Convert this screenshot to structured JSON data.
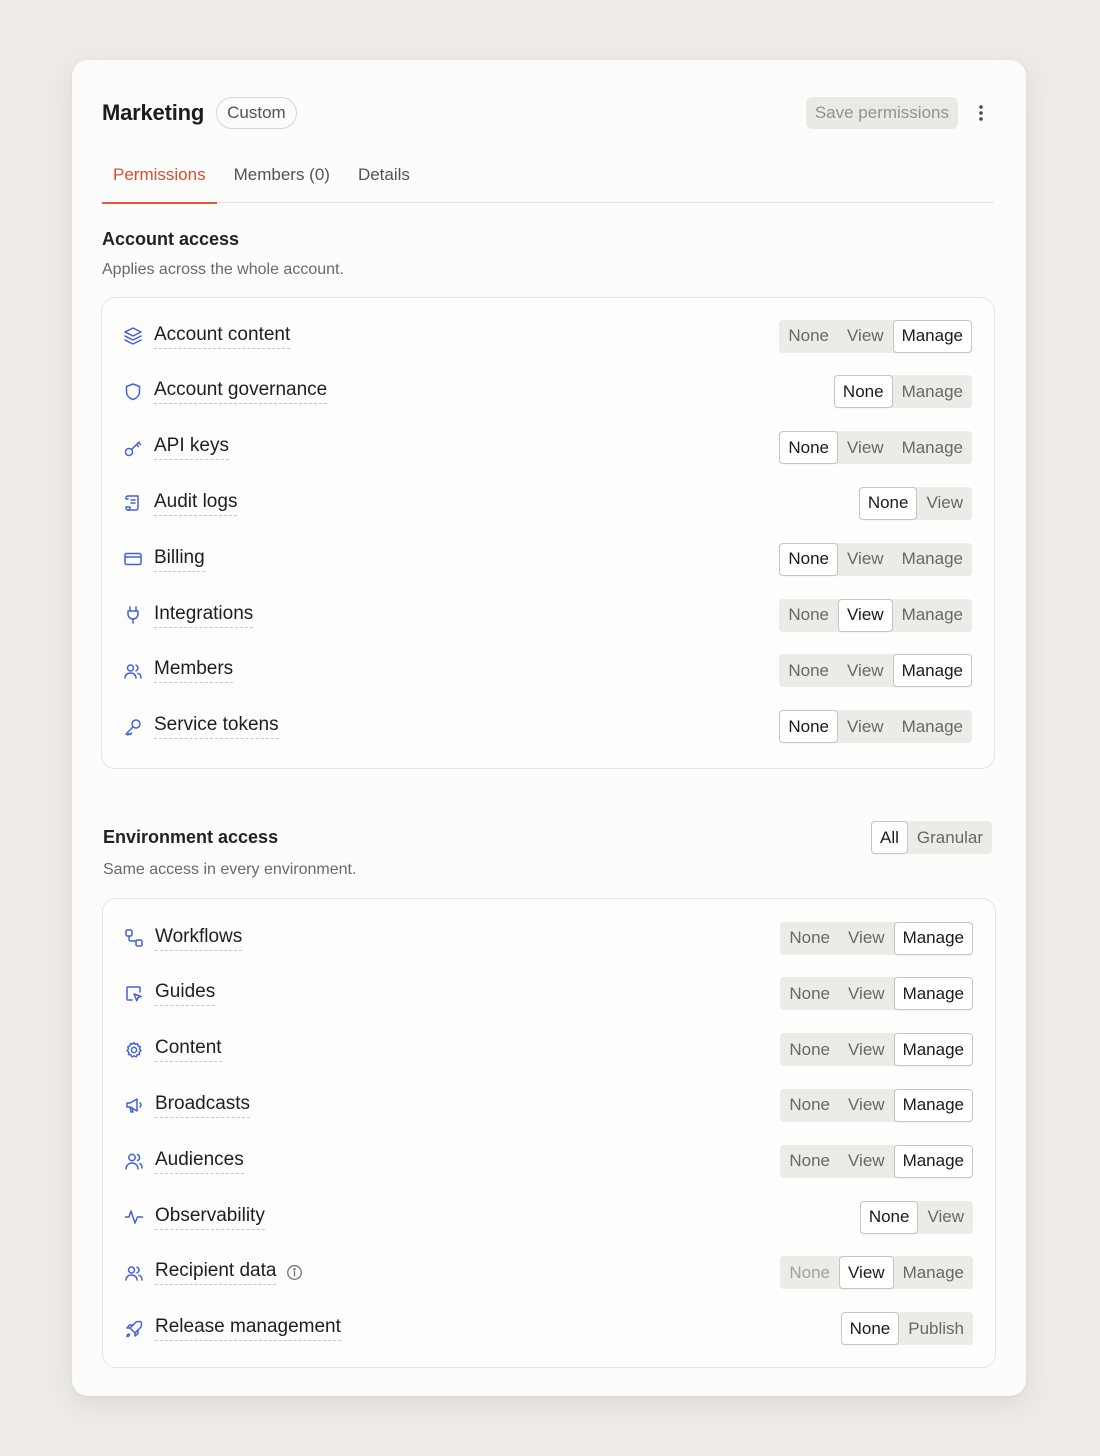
{
  "header": {
    "title": "Marketing",
    "badge": "Custom",
    "save_label": "Save permissions",
    "more_icon": "more-vertical-icon"
  },
  "tabs": [
    {
      "label": "Permissions",
      "active": true
    },
    {
      "label": "Members (0)",
      "active": false
    },
    {
      "label": "Details",
      "active": false
    }
  ],
  "account_access": {
    "title": "Account access",
    "subtitle": "Applies across the whole account.",
    "rows": [
      {
        "label": "Account content",
        "icon": "layers-icon",
        "options": [
          "None",
          "View",
          "Manage"
        ],
        "selected": "Manage"
      },
      {
        "label": "Account governance",
        "icon": "shield-icon",
        "options": [
          "None",
          "Manage"
        ],
        "selected": "None"
      },
      {
        "label": "API keys",
        "icon": "key-icon",
        "options": [
          "None",
          "View",
          "Manage"
        ],
        "selected": "None"
      },
      {
        "label": "Audit logs",
        "icon": "scroll-icon",
        "options": [
          "None",
          "View"
        ],
        "selected": "None"
      },
      {
        "label": "Billing",
        "icon": "credit-card-icon",
        "options": [
          "None",
          "View",
          "Manage"
        ],
        "selected": "None"
      },
      {
        "label": "Integrations",
        "icon": "plug-icon",
        "options": [
          "None",
          "View",
          "Manage"
        ],
        "selected": "View"
      },
      {
        "label": "Members",
        "icon": "users-icon",
        "options": [
          "None",
          "View",
          "Manage"
        ],
        "selected": "Manage"
      },
      {
        "label": "Service tokens",
        "icon": "wrench-key-icon",
        "options": [
          "None",
          "View",
          "Manage"
        ],
        "selected": "None"
      }
    ]
  },
  "environment_access": {
    "title": "Environment access",
    "subtitle": "Same access in every environment.",
    "mode_options": [
      "All",
      "Granular"
    ],
    "mode_selected": "All",
    "rows": [
      {
        "label": "Workflows",
        "icon": "workflow-icon",
        "options": [
          "None",
          "View",
          "Manage"
        ],
        "selected": "Manage"
      },
      {
        "label": "Guides",
        "icon": "cursor-frame-icon",
        "options": [
          "None",
          "View",
          "Manage"
        ],
        "selected": "Manage"
      },
      {
        "label": "Content",
        "icon": "settings-gear-icon",
        "options": [
          "None",
          "View",
          "Manage"
        ],
        "selected": "Manage"
      },
      {
        "label": "Broadcasts",
        "icon": "megaphone-icon",
        "options": [
          "None",
          "View",
          "Manage"
        ],
        "selected": "Manage"
      },
      {
        "label": "Audiences",
        "icon": "user-group-icon",
        "options": [
          "None",
          "View",
          "Manage"
        ],
        "selected": "Manage"
      },
      {
        "label": "Observability",
        "icon": "activity-icon",
        "options": [
          "None",
          "View"
        ],
        "selected": "None"
      },
      {
        "label": "Recipient data",
        "icon": "users-icon",
        "info": true,
        "options": [
          "None",
          "View",
          "Manage"
        ],
        "selected": "View",
        "disabled": [
          "None"
        ]
      },
      {
        "label": "Release management",
        "icon": "rocket-icon",
        "options": [
          "None",
          "Publish"
        ],
        "selected": "None"
      }
    ]
  },
  "colors": {
    "accent": "#e8573f",
    "icon": "#4361d8",
    "background": "#efece7",
    "card": "#fcfcfb"
  }
}
